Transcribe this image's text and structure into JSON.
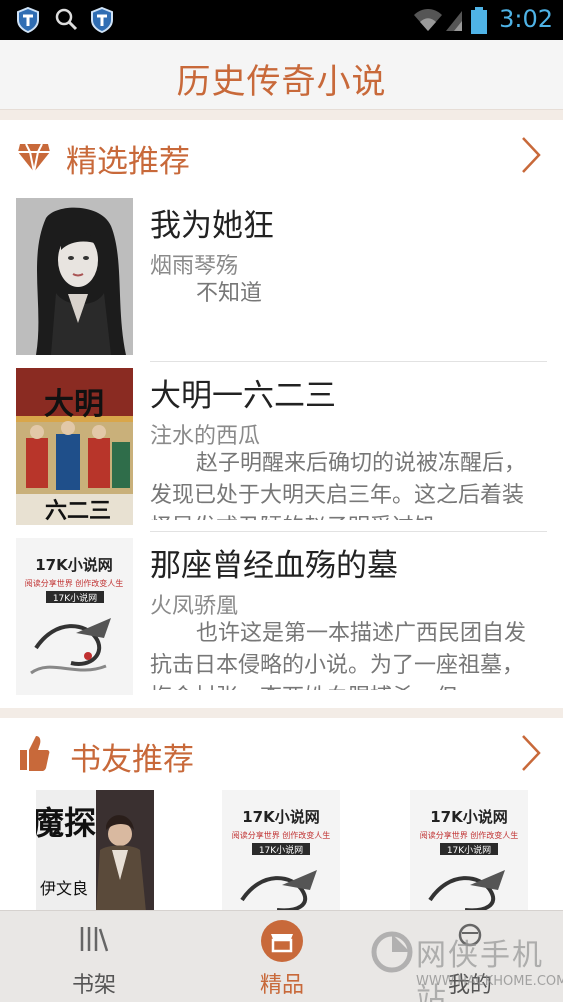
{
  "status_bar": {
    "time": "3:02",
    "icons": [
      "shield-icon",
      "search-icon",
      "shield-icon",
      "wifi-icon",
      "signal-icon",
      "battery-icon"
    ]
  },
  "header": {
    "title": "历史传奇小说"
  },
  "featured": {
    "title": "精选推荐",
    "icon": "gem-icon",
    "books": [
      {
        "title": "我为她狂",
        "author": "烟雨琴殇",
        "desc": "不知道"
      },
      {
        "title": "大明一六二三",
        "author": "注水的西瓜",
        "desc": "赵子明醒来后确切的说被冻醒后，发现已处于大明天启三年。这之后着装怪异发式丑陋的赵子明受过饥"
      },
      {
        "title": "那座曾经血殇的墓",
        "author": "火凤骄凰",
        "desc": "也许这是第一本描述广西民团自发抗击日本侵略的小说。为了一座祖墓，梅会村张、李两姓血腥搏杀，但"
      }
    ],
    "cover_text": {
      "ming_top": "大明",
      "ming_bottom": "六二三",
      "site_name": "17K小说网",
      "site_slogan": "阅读分享世界 创作改变人生",
      "site_logo": "17K小说网"
    }
  },
  "friends": {
    "title": "书友推荐",
    "icon": "thumbs-up-icon",
    "covers": [
      {
        "text_main": "魔探",
        "text_author": "伊文良"
      },
      {
        "site_name": "17K小说网",
        "site_slogan": "阅读分享世界 创作改变人生",
        "site_logo": "17K小说网"
      },
      {
        "site_name": "17K小说网",
        "site_slogan": "阅读分享世界 创作改变人生",
        "site_logo": "17K小说网"
      }
    ]
  },
  "bottom_nav": {
    "items": [
      {
        "label": "书架",
        "icon": "bookshelf-icon"
      },
      {
        "label": "精品",
        "icon": "store-icon",
        "active": true
      },
      {
        "label": "我的",
        "icon": "profile-icon"
      }
    ]
  },
  "watermark": {
    "text": "网侠手机站",
    "url": "WWW.HACKHOME.COM"
  },
  "colors": {
    "accent": "#c8693a",
    "status_blue": "#4fb3e6",
    "background": "#f3ece6"
  }
}
